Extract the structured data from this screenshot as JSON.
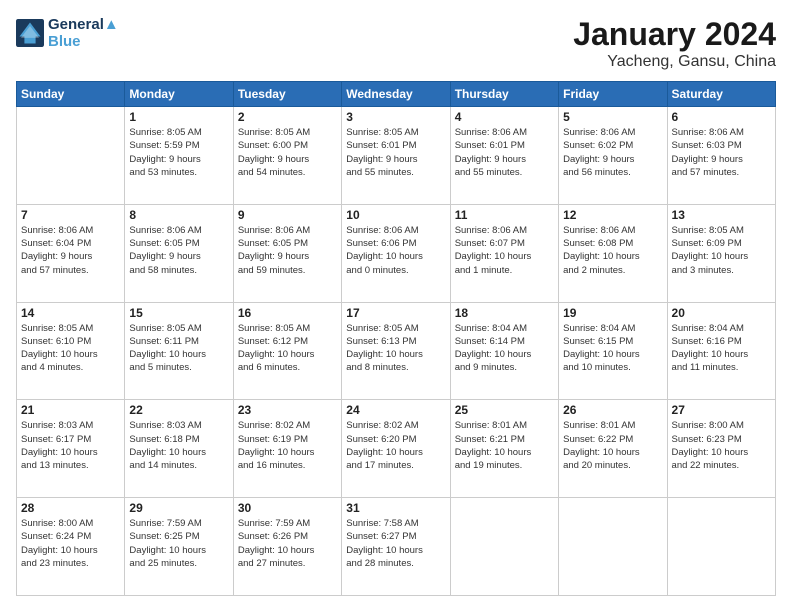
{
  "logo": {
    "line1": "General",
    "line2": "Blue"
  },
  "header": {
    "month": "January 2024",
    "location": "Yacheng, Gansu, China"
  },
  "weekdays": [
    "Sunday",
    "Monday",
    "Tuesday",
    "Wednesday",
    "Thursday",
    "Friday",
    "Saturday"
  ],
  "weeks": [
    [
      {
        "day": "",
        "info": ""
      },
      {
        "day": "1",
        "info": "Sunrise: 8:05 AM\nSunset: 5:59 PM\nDaylight: 9 hours\nand 53 minutes."
      },
      {
        "day": "2",
        "info": "Sunrise: 8:05 AM\nSunset: 6:00 PM\nDaylight: 9 hours\nand 54 minutes."
      },
      {
        "day": "3",
        "info": "Sunrise: 8:05 AM\nSunset: 6:01 PM\nDaylight: 9 hours\nand 55 minutes."
      },
      {
        "day": "4",
        "info": "Sunrise: 8:06 AM\nSunset: 6:01 PM\nDaylight: 9 hours\nand 55 minutes."
      },
      {
        "day": "5",
        "info": "Sunrise: 8:06 AM\nSunset: 6:02 PM\nDaylight: 9 hours\nand 56 minutes."
      },
      {
        "day": "6",
        "info": "Sunrise: 8:06 AM\nSunset: 6:03 PM\nDaylight: 9 hours\nand 57 minutes."
      }
    ],
    [
      {
        "day": "7",
        "info": "Sunrise: 8:06 AM\nSunset: 6:04 PM\nDaylight: 9 hours\nand 57 minutes."
      },
      {
        "day": "8",
        "info": "Sunrise: 8:06 AM\nSunset: 6:05 PM\nDaylight: 9 hours\nand 58 minutes."
      },
      {
        "day": "9",
        "info": "Sunrise: 8:06 AM\nSunset: 6:05 PM\nDaylight: 9 hours\nand 59 minutes."
      },
      {
        "day": "10",
        "info": "Sunrise: 8:06 AM\nSunset: 6:06 PM\nDaylight: 10 hours\nand 0 minutes."
      },
      {
        "day": "11",
        "info": "Sunrise: 8:06 AM\nSunset: 6:07 PM\nDaylight: 10 hours\nand 1 minute."
      },
      {
        "day": "12",
        "info": "Sunrise: 8:06 AM\nSunset: 6:08 PM\nDaylight: 10 hours\nand 2 minutes."
      },
      {
        "day": "13",
        "info": "Sunrise: 8:05 AM\nSunset: 6:09 PM\nDaylight: 10 hours\nand 3 minutes."
      }
    ],
    [
      {
        "day": "14",
        "info": "Sunrise: 8:05 AM\nSunset: 6:10 PM\nDaylight: 10 hours\nand 4 minutes."
      },
      {
        "day": "15",
        "info": "Sunrise: 8:05 AM\nSunset: 6:11 PM\nDaylight: 10 hours\nand 5 minutes."
      },
      {
        "day": "16",
        "info": "Sunrise: 8:05 AM\nSunset: 6:12 PM\nDaylight: 10 hours\nand 6 minutes."
      },
      {
        "day": "17",
        "info": "Sunrise: 8:05 AM\nSunset: 6:13 PM\nDaylight: 10 hours\nand 8 minutes."
      },
      {
        "day": "18",
        "info": "Sunrise: 8:04 AM\nSunset: 6:14 PM\nDaylight: 10 hours\nand 9 minutes."
      },
      {
        "day": "19",
        "info": "Sunrise: 8:04 AM\nSunset: 6:15 PM\nDaylight: 10 hours\nand 10 minutes."
      },
      {
        "day": "20",
        "info": "Sunrise: 8:04 AM\nSunset: 6:16 PM\nDaylight: 10 hours\nand 11 minutes."
      }
    ],
    [
      {
        "day": "21",
        "info": "Sunrise: 8:03 AM\nSunset: 6:17 PM\nDaylight: 10 hours\nand 13 minutes."
      },
      {
        "day": "22",
        "info": "Sunrise: 8:03 AM\nSunset: 6:18 PM\nDaylight: 10 hours\nand 14 minutes."
      },
      {
        "day": "23",
        "info": "Sunrise: 8:02 AM\nSunset: 6:19 PM\nDaylight: 10 hours\nand 16 minutes."
      },
      {
        "day": "24",
        "info": "Sunrise: 8:02 AM\nSunset: 6:20 PM\nDaylight: 10 hours\nand 17 minutes."
      },
      {
        "day": "25",
        "info": "Sunrise: 8:01 AM\nSunset: 6:21 PM\nDaylight: 10 hours\nand 19 minutes."
      },
      {
        "day": "26",
        "info": "Sunrise: 8:01 AM\nSunset: 6:22 PM\nDaylight: 10 hours\nand 20 minutes."
      },
      {
        "day": "27",
        "info": "Sunrise: 8:00 AM\nSunset: 6:23 PM\nDaylight: 10 hours\nand 22 minutes."
      }
    ],
    [
      {
        "day": "28",
        "info": "Sunrise: 8:00 AM\nSunset: 6:24 PM\nDaylight: 10 hours\nand 23 minutes."
      },
      {
        "day": "29",
        "info": "Sunrise: 7:59 AM\nSunset: 6:25 PM\nDaylight: 10 hours\nand 25 minutes."
      },
      {
        "day": "30",
        "info": "Sunrise: 7:59 AM\nSunset: 6:26 PM\nDaylight: 10 hours\nand 27 minutes."
      },
      {
        "day": "31",
        "info": "Sunrise: 7:58 AM\nSunset: 6:27 PM\nDaylight: 10 hours\nand 28 minutes."
      },
      {
        "day": "",
        "info": ""
      },
      {
        "day": "",
        "info": ""
      },
      {
        "day": "",
        "info": ""
      }
    ]
  ]
}
